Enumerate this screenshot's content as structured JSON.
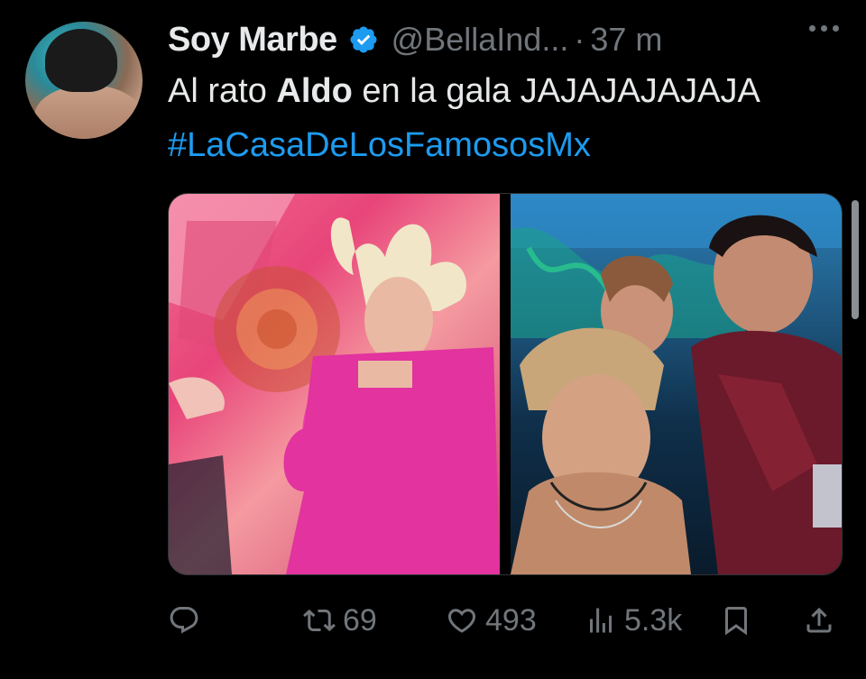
{
  "tweet": {
    "author_name": "Soy Marbe",
    "handle": "@BellaInd...",
    "separator": "·",
    "time": "37 m",
    "text_before": "Al rato ",
    "text_bold": "Aldo",
    "text_after": " en la gala JAJAJAJAJAJA",
    "hashtag": "#LaCasaDeLosFamososMx"
  },
  "actions": {
    "reply_icon": "reply-icon",
    "retweets": "69",
    "likes": "493",
    "views": "5.3k"
  },
  "colors": {
    "background": "#000000",
    "text": "#e7e9ea",
    "muted": "#71767b",
    "link": "#1d9bf0",
    "verified": "#1d9bf0"
  }
}
